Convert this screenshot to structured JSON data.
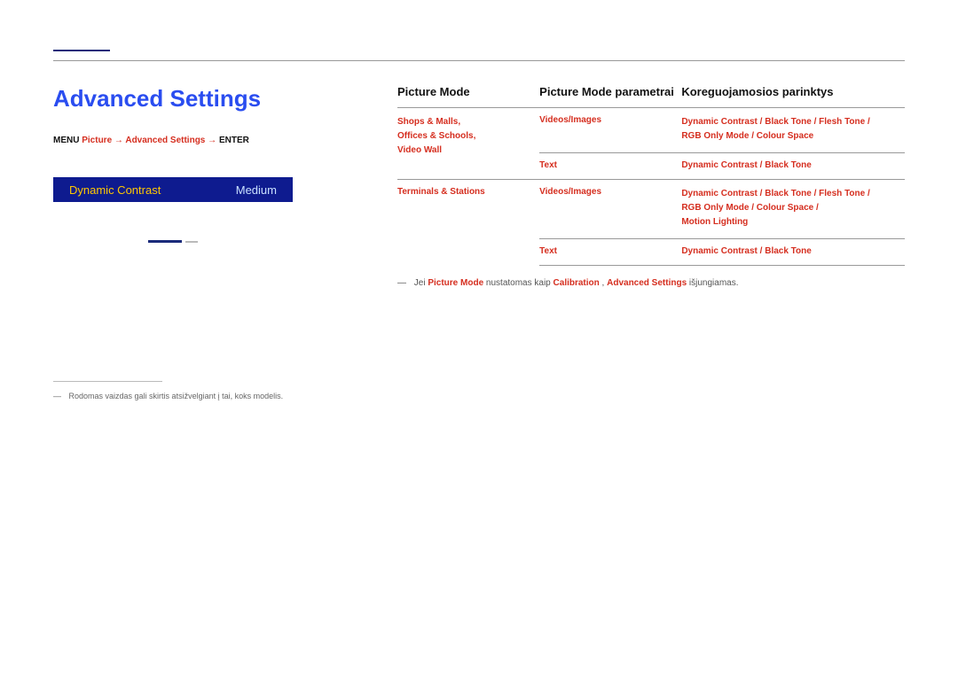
{
  "title": "Advanced Settings",
  "path": {
    "menu": "MENU",
    "p1": "Picture",
    "arrow1": "→",
    "p2": "Advanced Settings",
    "arrow2": "→",
    "enter": "ENTER"
  },
  "card": {
    "label": "Dynamic Contrast",
    "value": "Medium"
  },
  "footnote": "Rodomas vaizdas gali skirtis atsižvelgiant į tai, koks modelis.",
  "dash": "―",
  "table": {
    "h1": "Picture Mode",
    "h2": "Picture Mode parametrai",
    "h3": "Koreguojamosios parinktys",
    "rows": [
      {
        "c1": [
          "Shops & Malls,",
          "Offices & Schools,",
          "Video Wall"
        ],
        "c2": "Videos/Images",
        "c3": [
          "Dynamic Contrast / Black Tone / Flesh Tone /",
          "RGB Only Mode / Colour Space"
        ]
      },
      {
        "c1": "",
        "c2": "Text",
        "c3": "Dynamic Contrast / Black Tone"
      },
      {
        "c1": "Terminals & Stations",
        "c2": "Videos/Images",
        "c3": [
          "Dynamic Contrast / Black Tone / Flesh Tone /",
          "RGB Only Mode / Colour Space /",
          "Motion Lighting"
        ]
      },
      {
        "c1": "",
        "c2": "Text",
        "c3": "Dynamic Contrast / Black Tone"
      }
    ]
  },
  "tnote": {
    "t1": "Jei ",
    "r1": "Picture Mode",
    "t2": " nustatomas kaip ",
    "r2": "Calibration",
    "t3": ", ",
    "r3": "Advanced Settings",
    "t4": " išjungiamas."
  }
}
